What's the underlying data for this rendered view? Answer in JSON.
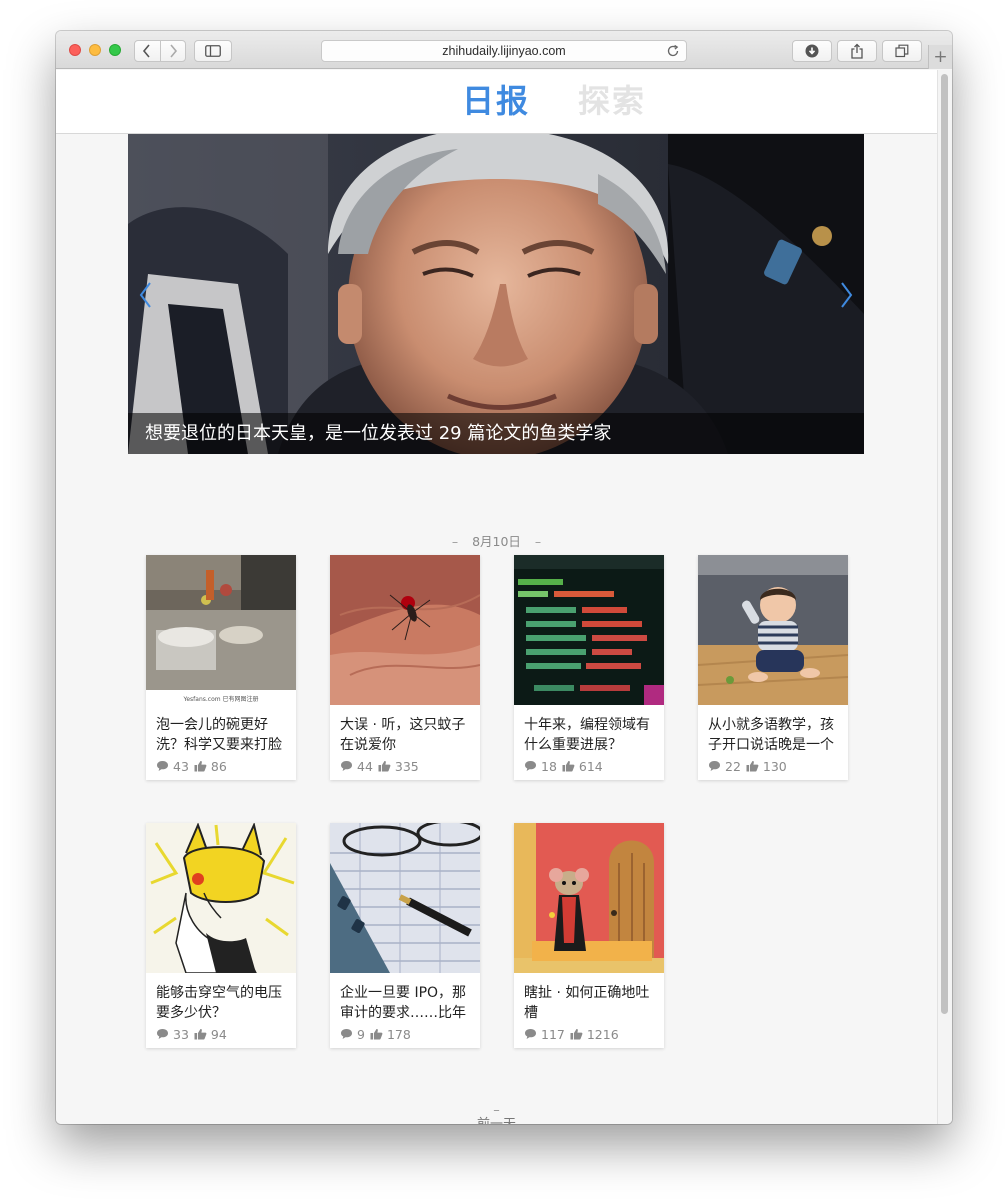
{
  "browser": {
    "url": "zhihudaily.lijinyao.com",
    "newtab_label": "+"
  },
  "nav": {
    "daily": "日报",
    "explore": "探索"
  },
  "banner": {
    "caption": "想要退位的日本天皇，是一位发表过 29 篇论文的鱼类学家"
  },
  "date_label": "8月10日",
  "dash": "–",
  "stories": [
    {
      "title": "泡一会儿的碗更好洗？科学又要来打脸",
      "comments": "43",
      "likes": "86",
      "thumb_caption": "Yesfans.com 已有网图注册"
    },
    {
      "title": "大误 · 听，这只蚊子在说爱你",
      "comments": "44",
      "likes": "335"
    },
    {
      "title": "十年来，编程领域有什么重要进展？",
      "comments": "18",
      "likes": "614"
    },
    {
      "title": "从小就多语教学，孩子开口说话晚是一个",
      "comments": "22",
      "likes": "130"
    },
    {
      "title": "能够击穿空气的电压要多少伏？",
      "comments": "33",
      "likes": "94"
    },
    {
      "title": "企业一旦要 IPO，那审计的要求……比年",
      "comments": "9",
      "likes": "178"
    },
    {
      "title": "瞎扯 · 如何正确地吐槽",
      "comments": "117",
      "likes": "1216"
    }
  ],
  "pager": {
    "prev_day": "前一天",
    "dash": "–"
  }
}
